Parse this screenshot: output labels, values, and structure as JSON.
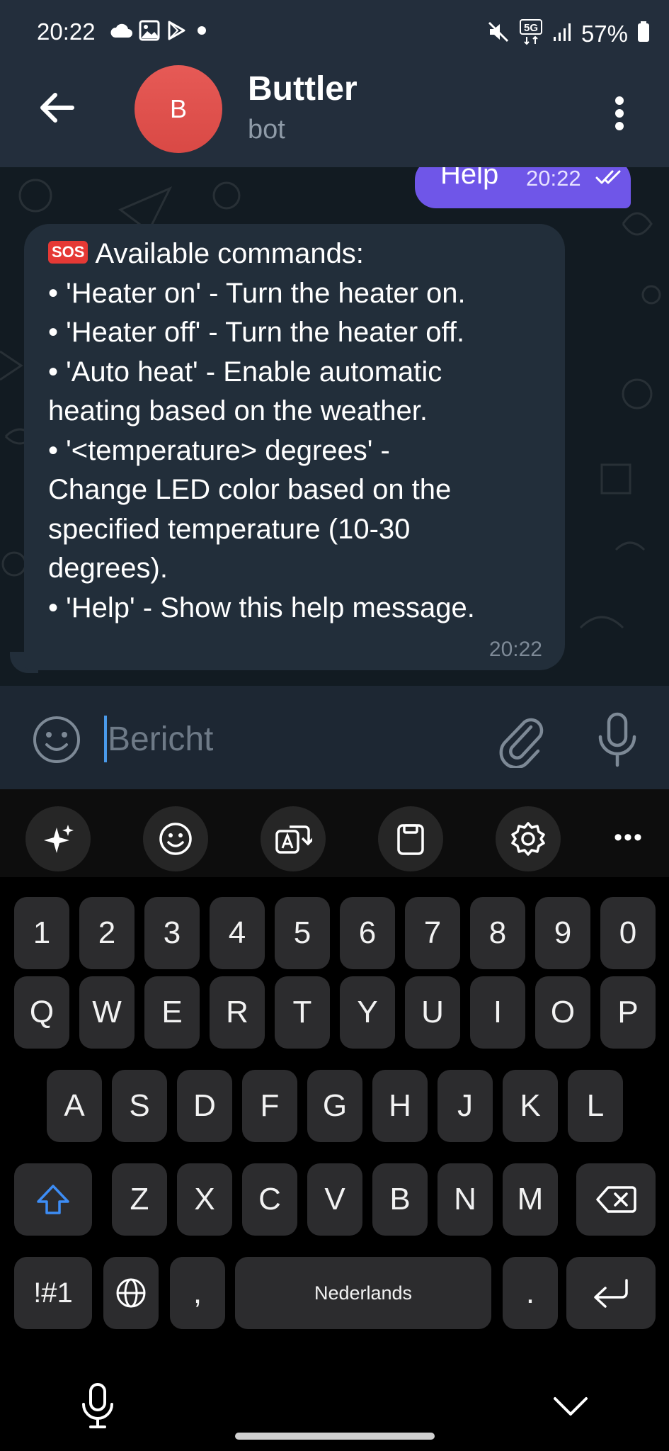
{
  "status_bar": {
    "time": "20:22",
    "battery": "57%",
    "network": "5G",
    "left_icons": [
      "cloud-icon",
      "image-icon",
      "play-store-icon",
      "dot-icon"
    ],
    "right_icons": [
      "mute-icon",
      "5g-icon",
      "signal-icon",
      "battery-icon"
    ]
  },
  "chat_header": {
    "avatar_letter": "B",
    "avatar_color": "#e0504c",
    "title": "Buttler",
    "subtitle": "bot"
  },
  "messages": {
    "outgoing": {
      "text": "Help",
      "time": "20:22",
      "status": "read",
      "color": "#6f56e8"
    },
    "incoming": {
      "emoji": "SOS",
      "lines": [
        "Available commands:",
        "• 'Heater on' - Turn the heater on.",
        "• 'Heater off' - Turn the heater off.",
        "• 'Auto heat' - Enable automatic",
        "heating based on the weather.",
        "• '<temperature> degrees' -",
        "Change LED color based on the",
        "specified temperature (10-30",
        "degrees).",
        "• 'Help' - Show this help message."
      ],
      "time": "20:22"
    }
  },
  "composer": {
    "placeholder": "Bericht",
    "value": ""
  },
  "keyboard": {
    "toolbar_icons": [
      "sparkle-icon",
      "emoji-icon",
      "translate-icon",
      "clipboard-icon",
      "settings-icon",
      "more-icon"
    ],
    "row_numbers": [
      "1",
      "2",
      "3",
      "4",
      "5",
      "6",
      "7",
      "8",
      "9",
      "0"
    ],
    "row_q": [
      "Q",
      "W",
      "E",
      "R",
      "T",
      "Y",
      "U",
      "I",
      "O",
      "P"
    ],
    "row_a": [
      "A",
      "S",
      "D",
      "F",
      "G",
      "H",
      "J",
      "K",
      "L"
    ],
    "row_z": [
      "Z",
      "X",
      "C",
      "V",
      "B",
      "N",
      "M"
    ],
    "symbols_key": "!#1",
    "comma_key": ",",
    "space_key": "Nederlands",
    "period_key": ".",
    "shift_active_color": "#3d8df5"
  },
  "colors": {
    "header_bg": "#232e3c",
    "chat_bg": "#121b22",
    "incoming_bubble": "#222e3a",
    "composer_bg": "#1d2733",
    "key_bg": "#2c2c2e"
  }
}
